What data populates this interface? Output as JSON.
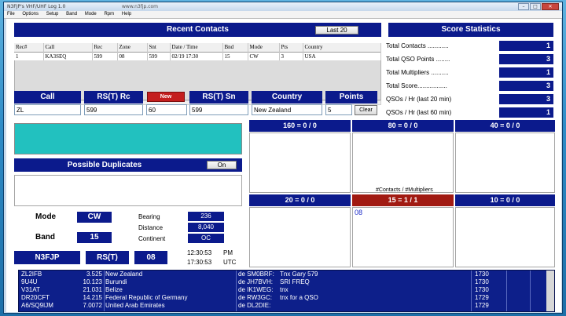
{
  "window": {
    "title": "N3FJP's VHF/UHF Log 1.0",
    "center_text": "www.n3fjp.com",
    "controls": [
      "–",
      "□",
      "✕"
    ]
  },
  "menu": [
    "File",
    "Options",
    "Setup",
    "Band",
    "Mode",
    "Rpm",
    "Help"
  ],
  "recent_contacts": {
    "title": "Recent Contacts",
    "button": "Last 20",
    "columns": [
      "Rec#",
      "Call",
      "Rec",
      "Zone",
      "Snt",
      "Date / Time",
      "Bnd",
      "Mode",
      "Pts",
      "Country"
    ],
    "rows": [
      [
        "1",
        "KA3SEQ",
        "599",
        "08",
        "599",
        "02/19 17:30",
        "15",
        "CW",
        "3",
        "USA"
      ]
    ]
  },
  "score": {
    "title": "Score Statistics",
    "items": [
      {
        "label": "Total Contacts ............",
        "value": "1"
      },
      {
        "label": "Total QSO Points ........",
        "value": "3"
      },
      {
        "label": "Total Multipliers ..........",
        "value": "1"
      },
      {
        "label": "Total Score.................",
        "value": "3"
      },
      {
        "label": "QSOs / Hr (last 20 min)",
        "value": "3"
      },
      {
        "label": "QSOs / Hr (last 60 min)",
        "value": "1"
      }
    ]
  },
  "entry": {
    "call_label": "Call",
    "call_value": "ZL",
    "rst_rcvd_label": "RS(T) Rc",
    "rst_rcvd_value": "599",
    "new_button": "New",
    "zone_value": "60",
    "rst_sent_label": "RS(T) Sn",
    "rst_sent_value": "599",
    "country_label": "Country",
    "country_value": "New Zealand",
    "points_label": "Points",
    "points_value": "5",
    "clear_button": "Clear"
  },
  "duplicates": {
    "title": "Possible Duplicates",
    "toggle": "On"
  },
  "station": {
    "mode_label": "Mode",
    "mode_value": "CW",
    "band_label": "Band",
    "band_value": "15",
    "bearing_label": "Bearing",
    "bearing_value": "236",
    "distance_label": "Distance",
    "distance_value": "8,040",
    "continent_label": "Continent",
    "continent_value": "OC",
    "operator": "N3FJP",
    "rst_label": "RS(T)",
    "zone": "08",
    "local_time": "12:30:53",
    "local_suffix": "PM",
    "utc_time": "17:30:53",
    "utc_suffix": "UTC"
  },
  "bands": {
    "caption": "#Contacts / #Multipliers",
    "items": [
      {
        "label": "160 = 0 / 0",
        "content": ""
      },
      {
        "label": "80 = 0 / 0",
        "content": ""
      },
      {
        "label": "40 = 0 / 0",
        "content": ""
      },
      {
        "label": "20 = 0 / 0",
        "content": ""
      },
      {
        "label": "15 = 1 / 1",
        "content": "08",
        "active": true
      },
      {
        "label": "10 = 0 / 0",
        "content": ""
      }
    ]
  },
  "spots": [
    {
      "call": "ZL2IFB",
      "freq": "3.525",
      "country": "New Zealand",
      "spotter": "de SM0BRF:",
      "comment": "Tnx Gary 579",
      "time": "1730"
    },
    {
      "call": "9U4U",
      "freq": "10.123",
      "country": "Burundi",
      "spotter": "de JH7BVH:",
      "comment": "SRI FREQ",
      "time": "1730"
    },
    {
      "call": "V31AT",
      "freq": "21.031",
      "country": "Belize",
      "spotter": "de IK1WEG:",
      "comment": "tnx",
      "time": "1730"
    },
    {
      "call": "DR20CFT",
      "freq": "14.215",
      "country": "Federal Republic of Germany",
      "spotter": "de RW3GC:",
      "comment": "tnx for a QSO",
      "time": "1729"
    },
    {
      "call": "A6/SQ9IJM",
      "freq": "7.0072",
      "country": "United Arab Emirates",
      "spotter": "de DL2DIE:",
      "comment": "",
      "time": "1729"
    }
  ],
  "colors": {
    "header_blue": "#0b1a8c",
    "active_band_red": "#a11a12",
    "teal_panel": "#22c1bf"
  }
}
